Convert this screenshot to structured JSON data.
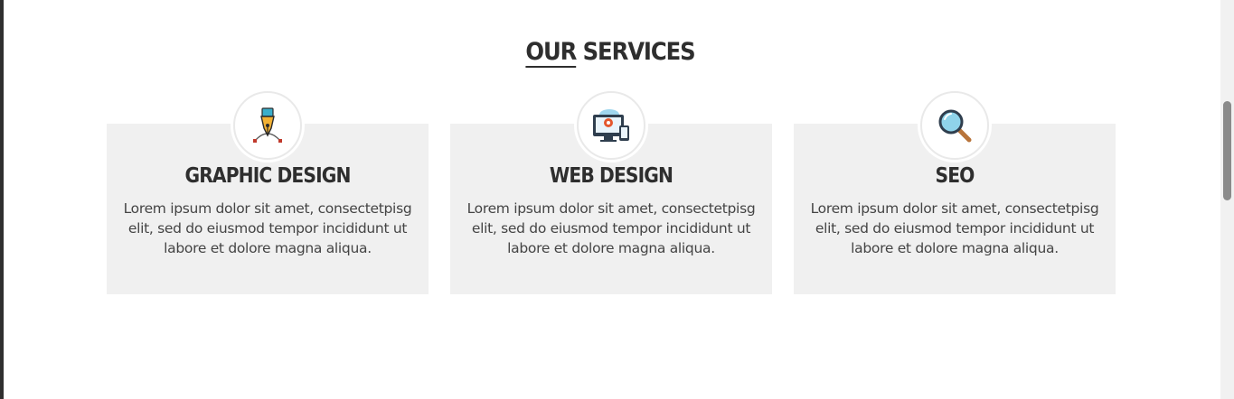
{
  "section": {
    "title_first": "OUR",
    "title_rest": " SERVICES"
  },
  "services": [
    {
      "title": "GRAPHIC DESIGN",
      "icon": "pen-tool-icon",
      "description": "Lorem ipsum dolor sit amet, consectetpisg elit, sed do eiusmod tempor incididunt ut labore et dolore magna aliqua."
    },
    {
      "title": "WEB DESIGN",
      "icon": "monitor-devices-icon",
      "description": "Lorem ipsum dolor sit amet, consectetpisg elit, sed do eiusmod tempor incididunt ut labore et dolore magna aliqua."
    },
    {
      "title": "SEO",
      "icon": "magnifier-icon",
      "description": "Lorem ipsum dolor sit amet, consectetpisg elit, sed do eiusmod tempor incididunt ut labore et dolore magna aliqua."
    }
  ],
  "colors": {
    "card_background": "#f0f0f0",
    "heading": "#2e2e2e",
    "accent": "#4aa6c9"
  }
}
